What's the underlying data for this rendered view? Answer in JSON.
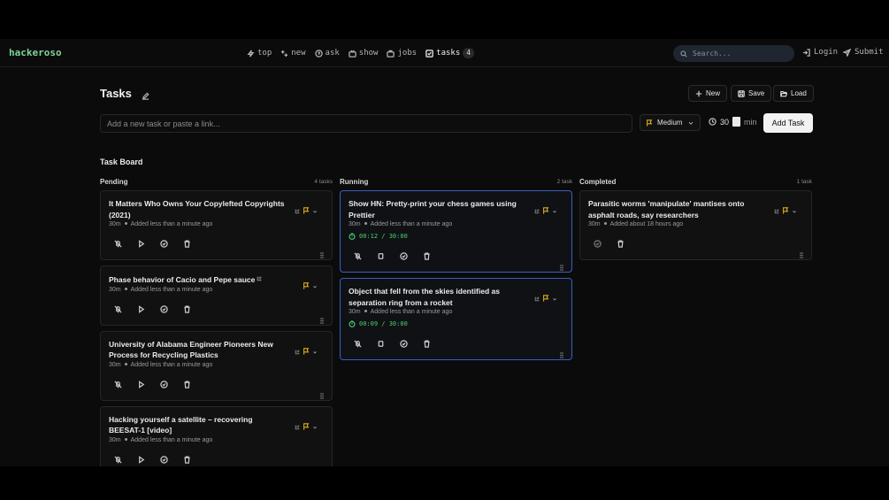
{
  "brand": "hackeroso",
  "nav": [
    {
      "label": "top",
      "icon": "zap-icon"
    },
    {
      "label": "new",
      "icon": "sparkles-icon"
    },
    {
      "label": "ask",
      "icon": "help-circle-icon"
    },
    {
      "label": "show",
      "icon": "tv-icon"
    },
    {
      "label": "jobs",
      "icon": "briefcase-icon"
    },
    {
      "label": "tasks",
      "icon": "check-square-icon",
      "badge": "4",
      "active": true
    }
  ],
  "search": {
    "placeholder": "Search..."
  },
  "header_links": {
    "login": "Login",
    "submit": "Submit"
  },
  "page": {
    "title": "Tasks",
    "toolbar": {
      "new": "New",
      "save": "Save",
      "load": "Load"
    }
  },
  "add_task": {
    "placeholder": "Add a new task or paste a link...",
    "priority": "Medium",
    "duration": "30",
    "duration_unit": "min",
    "button": "Add Task"
  },
  "board": {
    "title": "Task Board",
    "columns": [
      {
        "name": "Pending",
        "count": "4 tasks",
        "tasks": [
          {
            "title": "It Matters Who Owns Your Copylefted Copyrights (2021)",
            "duration": "30m",
            "added": "Added less than a minute ago"
          },
          {
            "title": "Phase behavior of Cacio and Pepe sauce",
            "duration": "30m",
            "added": "Added less than a minute ago"
          },
          {
            "title": "University of Alabama Engineer Pioneers New Process for Recycling Plastics",
            "duration": "30m",
            "added": "Added less than a minute ago"
          },
          {
            "title": "Hacking yourself a satellite – recovering BEESAT-1 [video]",
            "duration": "30m",
            "added": "Added less than a minute ago"
          }
        ]
      },
      {
        "name": "Running",
        "count": "2 task",
        "tasks": [
          {
            "title": "Show HN: Pretty-print your chess games using Prettier",
            "duration": "30m",
            "added": "Added less than a minute ago",
            "timer": "00:12 / 30:00"
          },
          {
            "title": "Object that fell from the skies identified as separation ring from a rocket",
            "duration": "30m",
            "added": "Added less than a minute ago",
            "timer": "00:09 / 30:00"
          }
        ]
      },
      {
        "name": "Completed",
        "count": "1 task",
        "tasks": [
          {
            "title": "Parasitic worms 'manipulate' mantises onto asphalt roads, say researchers",
            "duration": "30m",
            "added": "Added about 18 hours ago"
          }
        ]
      }
    ]
  },
  "colors": {
    "accent_green": "#7fd39a",
    "flag": "#e0b020",
    "running_border": "#3a5fbf",
    "timer": "#4ccf6b"
  }
}
